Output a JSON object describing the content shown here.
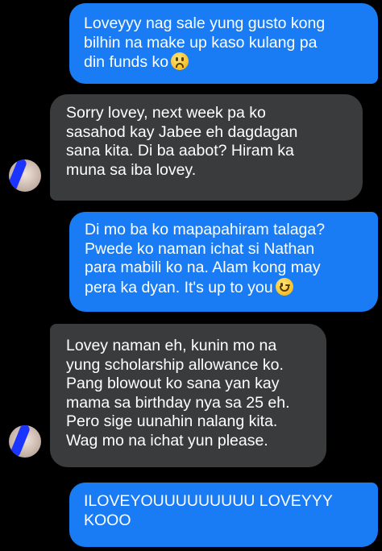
{
  "messages": [
    {
      "side": "sent",
      "text": "Loveyyy nag sale yung gusto kong\nbilhin na make up kaso kulang pa\ndin funds ko",
      "emoji": "worried-face"
    },
    {
      "side": "received",
      "text": "Sorry lovey, next week pa ko\nsasahod kay Jabee eh dagdagan\nsana kita. Di ba aabot? Hiram ka\nmuna sa iba lovey."
    },
    {
      "side": "sent",
      "text": "Di mo ba ko mapapahiram talaga?\nPwede ko naman ichat si Nathan\npara mabili ko na. Alam kong may\npera ka dyan. It's up to you",
      "emoji": "winking-face"
    },
    {
      "side": "received",
      "text": "Lovey naman eh, kunin mo na\nyung scholarship allowance ko.\nPang blowout ko sana yan kay\nmama sa birthday nya sa 25 eh.\nPero sige uunahin nalang kita.\nWag mo na ichat yun please."
    },
    {
      "side": "sent",
      "text": "ILOVEYOUUUUUUUUU LOVEYYY\nKOOO"
    }
  ],
  "colors": {
    "background": "#000000",
    "sent_bubble": "#1a7cf5",
    "received_bubble": "#3a3b3c",
    "text": "#ffffff",
    "redaction": "#1b35ff"
  }
}
